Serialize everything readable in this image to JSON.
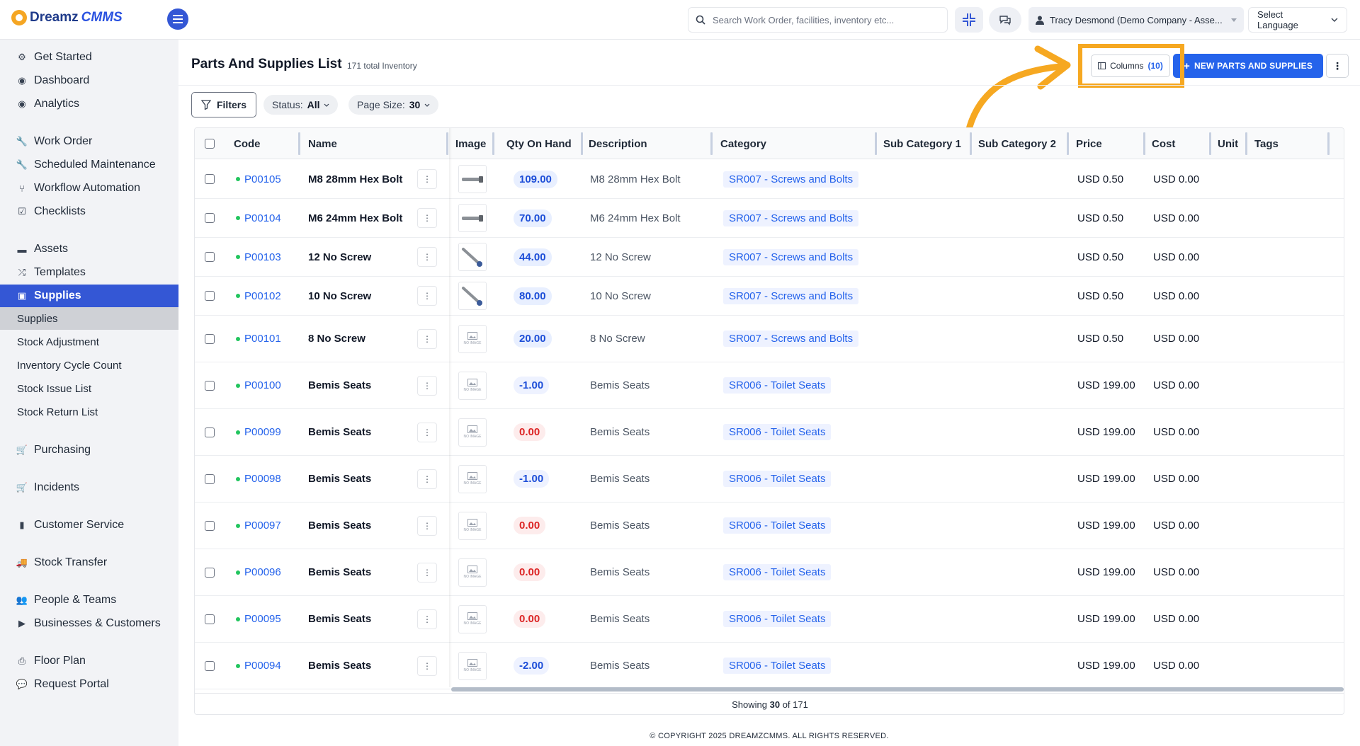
{
  "brand": {
    "part1": "Dreamz",
    "part2": "CMMS"
  },
  "search": {
    "placeholder": "Search Work Order, facilities, inventory etc..."
  },
  "user": {
    "label": "Tracy Desmond (Demo Company - Asse..."
  },
  "language": {
    "label": "Select Language"
  },
  "sidebar": {
    "items": [
      {
        "label": "Get Started",
        "icon": "gears-icon"
      },
      {
        "label": "Dashboard",
        "icon": "dashboard-icon"
      },
      {
        "label": "Analytics",
        "icon": "analytics-icon"
      },
      {
        "label": "Work Order",
        "icon": "wrench-icon"
      },
      {
        "label": "Scheduled Maintenance",
        "icon": "wrench-icon"
      },
      {
        "label": "Workflow Automation",
        "icon": "workflow-icon"
      },
      {
        "label": "Checklists",
        "icon": "checkbox-icon"
      },
      {
        "label": "Assets",
        "icon": "box-icon"
      },
      {
        "label": "Templates",
        "icon": "shuffle-icon"
      },
      {
        "label": "Supplies",
        "icon": "briefcase-icon"
      },
      {
        "label": "Purchasing",
        "icon": "cart-icon"
      },
      {
        "label": "Incidents",
        "icon": "cart-icon"
      },
      {
        "label": "Customer Service",
        "icon": "file-icon"
      },
      {
        "label": "Stock Transfer",
        "icon": "truck-icon"
      },
      {
        "label": "People & Teams",
        "icon": "users-icon"
      },
      {
        "label": "Businesses & Customers",
        "icon": "video-icon"
      },
      {
        "label": "Floor Plan",
        "icon": "print-icon"
      },
      {
        "label": "Request Portal",
        "icon": "chat-icon"
      }
    ],
    "sub_items": [
      "Supplies",
      "Stock Adjustment",
      "Inventory Cycle Count",
      "Stock Issue List",
      "Stock Return List"
    ]
  },
  "page": {
    "title": "Parts And Supplies List",
    "count": "171 total Inventory",
    "columns_label": "Columns",
    "columns_count": "(10)",
    "new_button": "NEW PARTS AND SUPPLIES"
  },
  "filters": {
    "filters_label": "Filters",
    "status_label": "Status:",
    "status_value": "All",
    "page_size_label": "Page Size:",
    "page_size_value": "30"
  },
  "table": {
    "headers": [
      "Code",
      "Name",
      "Image",
      "Qty On Hand",
      "Description",
      "Category",
      "Sub Category 1",
      "Sub Category 2",
      "Price",
      "Cost",
      "Unit",
      "Tags"
    ],
    "rows": [
      {
        "code": "P00105",
        "name": "M8 28mm Hex Bolt",
        "img": "bolt",
        "qty": "109.00",
        "qty_kind": "pos",
        "desc": "M8 28mm Hex Bolt",
        "cat": "SR007 - Screws and Bolts",
        "price": "USD 0.50",
        "cost": "USD 0.00"
      },
      {
        "code": "P00104",
        "name": "M6 24mm Hex Bolt",
        "img": "bolt",
        "qty": "70.00",
        "qty_kind": "pos",
        "desc": "M6 24mm Hex Bolt",
        "cat": "SR007 - Screws and Bolts",
        "price": "USD 0.50",
        "cost": "USD 0.00"
      },
      {
        "code": "P00103",
        "name": "12 No Screw",
        "img": "screw",
        "qty": "44.00",
        "qty_kind": "pos",
        "desc": "12 No Screw",
        "cat": "SR007 - Screws and Bolts",
        "price": "USD 0.50",
        "cost": "USD 0.00"
      },
      {
        "code": "P00102",
        "name": "10 No Screw",
        "img": "screw",
        "qty": "80.00",
        "qty_kind": "pos",
        "desc": "10 No Screw",
        "cat": "SR007 - Screws and Bolts",
        "price": "USD 0.50",
        "cost": "USD 0.00"
      },
      {
        "code": "P00101",
        "name": "8 No Screw",
        "img": "none",
        "qty": "20.00",
        "qty_kind": "pos",
        "desc": "8 No Screw",
        "cat": "SR007 - Screws and Bolts",
        "price": "USD 0.50",
        "cost": "USD 0.00"
      },
      {
        "code": "P00100",
        "name": "Bemis Seats",
        "img": "none",
        "qty": "-1.00",
        "qty_kind": "neg",
        "desc": "Bemis Seats",
        "cat": "SR006 - Toilet Seats",
        "price": "USD 199.00",
        "cost": "USD 0.00"
      },
      {
        "code": "P00099",
        "name": "Bemis Seats",
        "img": "none",
        "qty": "0.00",
        "qty_kind": "zero",
        "desc": "Bemis Seats",
        "cat": "SR006 - Toilet Seats",
        "price": "USD 199.00",
        "cost": "USD 0.00"
      },
      {
        "code": "P00098",
        "name": "Bemis Seats",
        "img": "none",
        "qty": "-1.00",
        "qty_kind": "neg",
        "desc": "Bemis Seats",
        "cat": "SR006 - Toilet Seats",
        "price": "USD 199.00",
        "cost": "USD 0.00"
      },
      {
        "code": "P00097",
        "name": "Bemis Seats",
        "img": "none",
        "qty": "0.00",
        "qty_kind": "zero",
        "desc": "Bemis Seats",
        "cat": "SR006 - Toilet Seats",
        "price": "USD 199.00",
        "cost": "USD 0.00"
      },
      {
        "code": "P00096",
        "name": "Bemis Seats",
        "img": "none",
        "qty": "0.00",
        "qty_kind": "zero",
        "desc": "Bemis Seats",
        "cat": "SR006 - Toilet Seats",
        "price": "USD 199.00",
        "cost": "USD 0.00"
      },
      {
        "code": "P00095",
        "name": "Bemis Seats",
        "img": "none",
        "qty": "0.00",
        "qty_kind": "zero",
        "desc": "Bemis Seats",
        "cat": "SR006 - Toilet Seats",
        "price": "USD 199.00",
        "cost": "USD 0.00"
      },
      {
        "code": "P00094",
        "name": "Bemis Seats",
        "img": "none",
        "qty": "-2.00",
        "qty_kind": "neg",
        "desc": "Bemis Seats",
        "cat": "SR006 - Toilet Seats",
        "price": "USD 199.00",
        "cost": "USD 0.00"
      }
    ],
    "no_image_text": "NO IMAGE"
  },
  "pagination": {
    "prefix": "Showing",
    "shown": "30",
    "of": "of",
    "total": "171"
  },
  "footer": {
    "copyright": "© COPYRIGHT 2025 DREAMZCMMS. ALL RIGHTS RESERVED."
  },
  "colors": {
    "accent": "#3457d5",
    "primary_button": "#2563eb",
    "highlight": "#f6a821",
    "status_dot": "#22c55e",
    "negative": "#dc2626"
  }
}
